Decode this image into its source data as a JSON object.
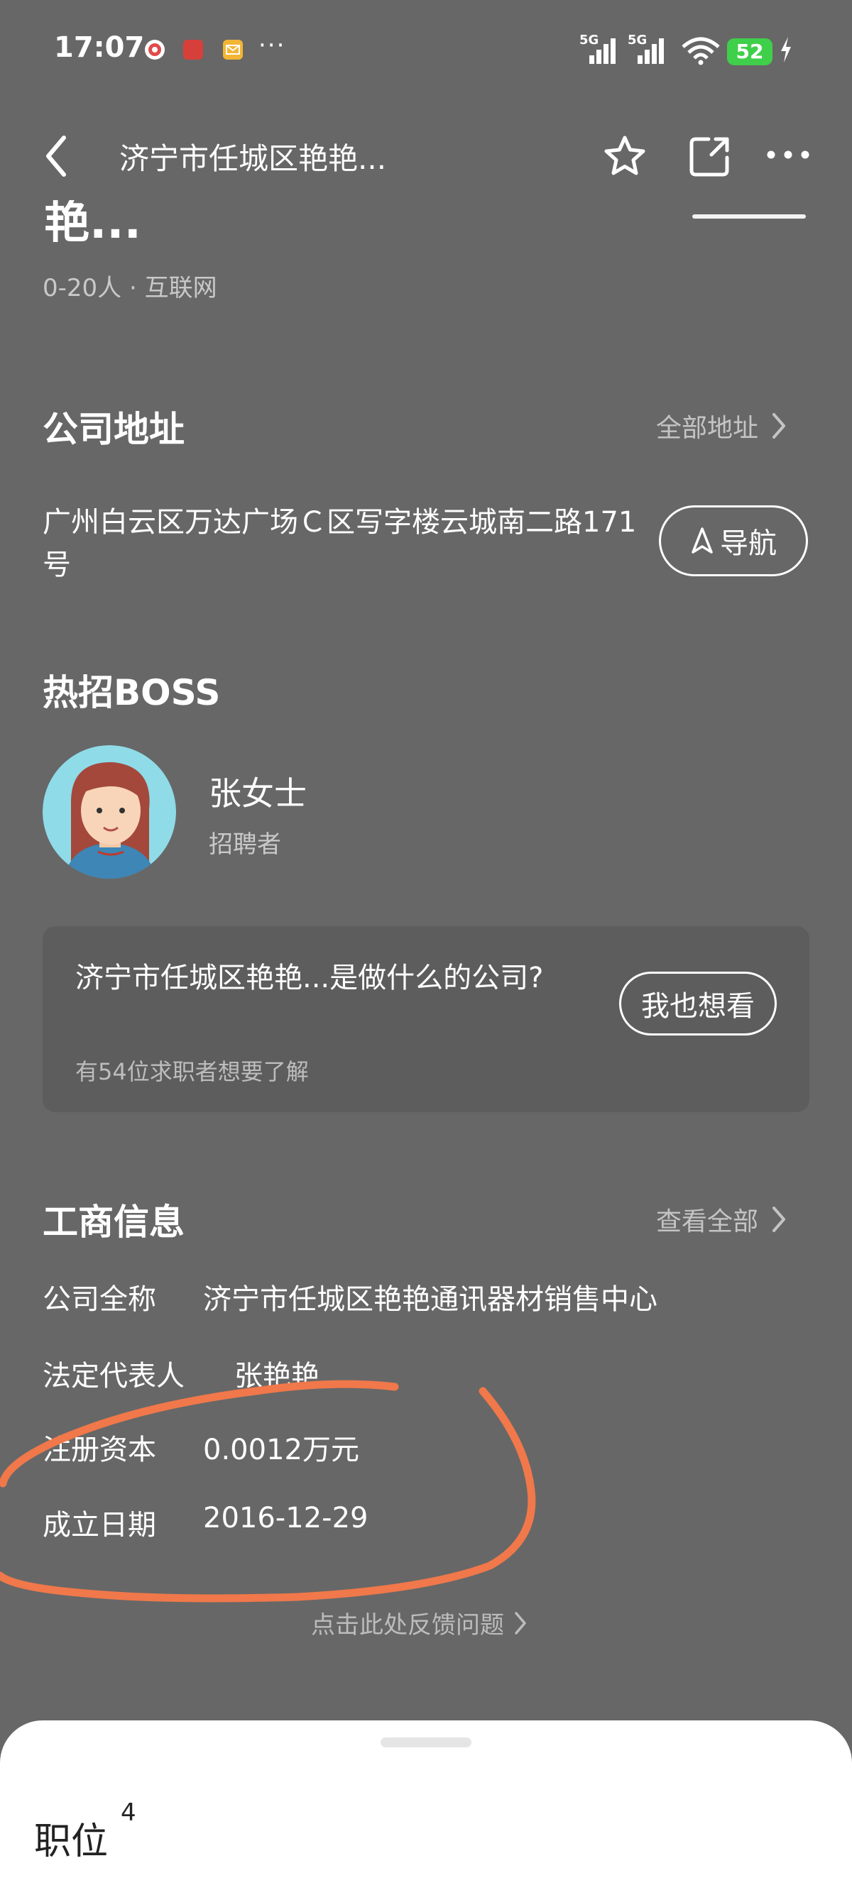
{
  "status": {
    "time": "17:07",
    "more": "···",
    "net1": "5G",
    "net2": "5G",
    "battery": "52"
  },
  "header": {
    "back": "back",
    "title": "济宁市任城区艳艳...",
    "favorite": "star",
    "share": "share",
    "more": "more"
  },
  "company": {
    "title_cut": "艳...",
    "meta": "0-20人 · 互联网"
  },
  "address": {
    "heading": "公司地址",
    "all_link": "全部地址",
    "text": "广州白云区万达广场Ｃ区写字楼云城南二路171号",
    "nav_button": "导航"
  },
  "boss": {
    "heading": "热招BOSS",
    "name": "张女士",
    "role": "招聘者"
  },
  "question": {
    "text": "济宁市任城区艳艳...是做什么的公司?",
    "sub": "有54位求职者想要了解",
    "button": "我也想看"
  },
  "business": {
    "heading": "工商信息",
    "all_link": "查看全部",
    "rows": [
      {
        "label": "公司全称",
        "value": "济宁市任城区艳艳通讯器材销售中心"
      },
      {
        "label": "法定代表人",
        "value": "张艳艳"
      },
      {
        "label": "注册资本",
        "value": "0.0012万元"
      },
      {
        "label": "成立日期",
        "value": "2016-12-29"
      }
    ]
  },
  "feedback": "点击此处反馈问题",
  "jobs": {
    "title": "职位",
    "count": "4"
  },
  "colors": {
    "background": "#676767",
    "annotation": "#f0784a",
    "battery": "#3fcf4a"
  }
}
